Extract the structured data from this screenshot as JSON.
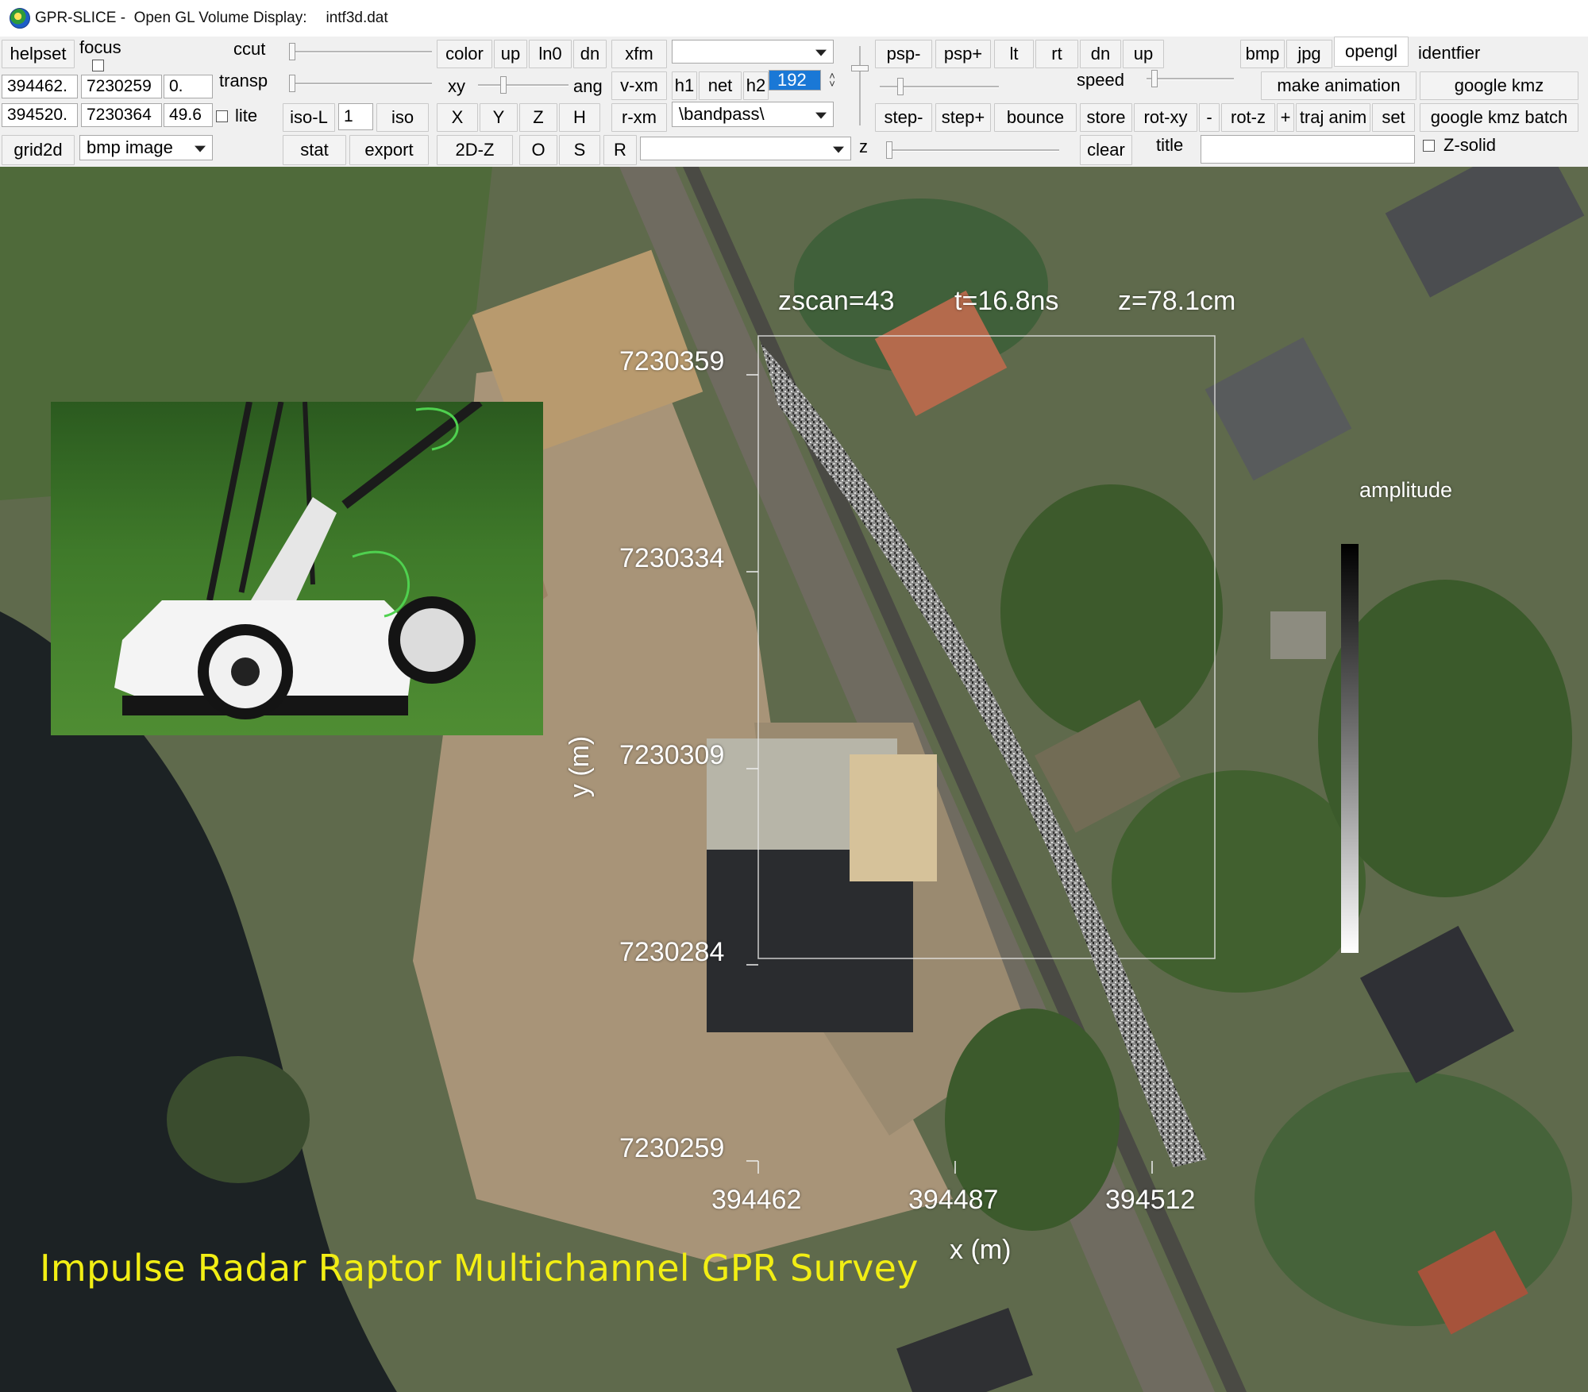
{
  "window": {
    "app_name": "GPR-SLICE -  Open GL Volume Display:",
    "file_name": "intf3d.dat"
  },
  "toolbar": {
    "helpset": "helpset",
    "focus": "focus",
    "ccut": "ccut",
    "transp": "transp",
    "coord_x1": "394462.",
    "coord_y1": "7230259",
    "coord_z1": "0.",
    "coord_x2": "394520.",
    "coord_y2": "7230364",
    "coord_z2": "49.6",
    "lite": "lite",
    "grid2d": "grid2d",
    "image_type": "bmp image",
    "iso_l": "iso-L",
    "iso_value": "1",
    "iso": "iso",
    "stat": "stat",
    "export": "export",
    "color": "color",
    "up": "up",
    "ln0": "ln0",
    "dn": "dn",
    "xy": "xy",
    "ang": "ang",
    "x_btn": "X",
    "y_btn": "Y",
    "z_btn": "Z",
    "h_btn": "H",
    "twod_z": "2D-Z",
    "o_btn": "O",
    "s_btn": "S",
    "r_btn": "R",
    "xfm": "xfm",
    "v_xm": "v-xm",
    "r_xm": "r-xm",
    "h1": "h1",
    "net": "net",
    "h2": "h2",
    "h2_value": "192",
    "filter": "\\bandpass\\",
    "z_label": "z",
    "psp_minus": "psp-",
    "psp_plus": "psp+",
    "lt": "lt",
    "rt": "rt",
    "dn2": "dn",
    "up2": "up",
    "speed": "speed",
    "step_minus": "step-",
    "step_plus": "step+",
    "bounce": "bounce",
    "store": "store",
    "rot_xy": "rot-xy",
    "minus": "-",
    "rot_z": "rot-z",
    "plus": "+",
    "traj_anim": "traj anim",
    "set": "set",
    "clear": "clear",
    "title": "title",
    "bmp": "bmp",
    "jpg": "jpg",
    "opengl": "opengl",
    "identfier": "identfier",
    "make_animation": "make animation",
    "google_kmz": "google kmz",
    "google_kmz_batch": "google kmz batch",
    "z_solid": "Z-solid"
  },
  "display": {
    "zscan": "zscan=43",
    "time": "t=16.8ns",
    "depth": "z=78.1cm",
    "y_axis_label": "y (m)",
    "x_axis_label": "x (m)",
    "y_ticks": [
      "7230359",
      "7230334",
      "7230309",
      "7230284",
      "7230259"
    ],
    "x_ticks": [
      "394462",
      "394487",
      "394512"
    ],
    "colorbar_label": "amplitude",
    "survey_title": "Impulse Radar Raptor Multichannel GPR Survey"
  }
}
